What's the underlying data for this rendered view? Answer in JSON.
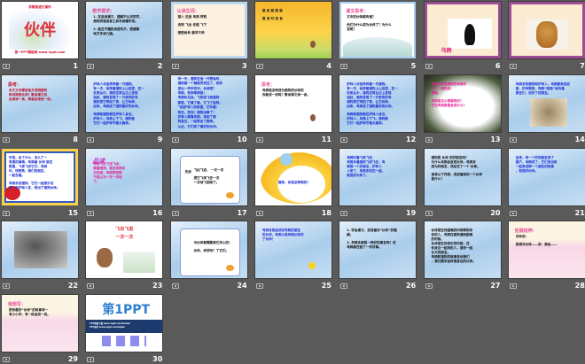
{
  "app": {
    "view": "slide-sorter",
    "total_slides": 30
  },
  "colors": {
    "background": "#5a5a5a",
    "title_pink": "#e8509a",
    "text_blue": "#1a2fd8",
    "text_red": "#d4102a"
  },
  "slides": [
    {
      "num": "1",
      "style": "white",
      "title": "伙伴",
      "title_color": "#e0303a",
      "title_pos": "center",
      "lines": [
        "苏教版语文课件",
        "第一PPT模板网 www.1ppt.com"
      ],
      "line_color": "#d4102a",
      "art": "drawing"
    },
    {
      "num": "2",
      "style": "blue",
      "title": "教学要求：",
      "title_color": "#e8509a",
      "lines": [
        "1. 在自读课文、理解不认识的字，",
        "借助拼音或者工具书读懂字词。",
        "",
        "2. 能在不懂的词语句子，把感情",
        "地方多读几遍。"
      ],
      "line_color": "#111"
    },
    {
      "num": "3",
      "style": "cream",
      "title": "认读生词：",
      "title_color": "#e8509a",
      "lines": [
        "猎人  迅速  鸟鸦  呼救",
        "",
        "食物  飞出  依据  飞下",
        "",
        "密密树林  暴风不停"
      ],
      "line_color": "#222",
      "art": "frame"
    },
    {
      "num": "4",
      "style": "orange",
      "title": "",
      "lines": [
        "猎  逐  躲  跳  躲",
        "",
        "害  虎  叼  滚  食"
      ],
      "line_color": "#222",
      "art": "bird"
    },
    {
      "num": "5",
      "style": "white",
      "title": "课文思考：",
      "title_color": "#e8509a",
      "lines": [
        "文中的伙伴都有谁？",
        "",
        "他们为什么成为伙伴了？为什么",
        "变呢？"
      ],
      "line_color": "#111",
      "art": "bluebox"
    },
    {
      "num": "6",
      "style": "purpleframe",
      "title": "乌鸦",
      "title_color": "#e8207a",
      "title_pos": "bottomleft",
      "lines": [],
      "art": "crow"
    },
    {
      "num": "7",
      "style": "purpleframe",
      "title": "",
      "lines": [],
      "art": "dog"
    },
    {
      "num": "8",
      "style": "blue",
      "title": "思考：",
      "title_color": "#c0102a",
      "lines": [
        "本文文中哪些地方说明猎狗",
        "和乌鸦是伙伴？默读课文找",
        "出来读一读，再画出来说一说。"
      ],
      "line_color": "#c0102a"
    },
    {
      "num": "9",
      "style": "blue",
      "title": "",
      "lines": [
        "护林人与他养养着一只猎狗。",
        "有一次，他带着猎狗上山巡逻，在一",
        "处草丛中，猎狗在草丛边上发现",
        "追赶，猎狗发现了一只受伤的鸟",
        "猎狗把它带回了家，让它休养，",
        "后来，鸟鸦成了猎狗最好的伙伴。",
        "",
        "鸟鸦和猎狗都在护林人身边，",
        "护林人，乌鸦上下飞，猎狗做",
        "它们一起护林守着大森林。"
      ],
      "line_color": "#1a2fd8"
    },
    {
      "num": "10",
      "style": "blue",
      "title": "",
      "lines": [
        "有一天，猎狗在追一只野兔时，",
        "猎狗被一个捕兽夹夹住了，疼得",
        "发出一声声哀叫，伙伴呢？",
        "鸟鸦，快来帮帮我！",
        "鸟鸦听见后，飞快地飞到猎狗",
        "那里，它看了看，又飞了起来，",
        "飞回护林人的家里，它叫着：",
        "快去，快去！猎狗出事了！",
        "护林人跟着鸟鸦，来到了猎",
        "狗身边，一起救出了猎狗。",
        "从此，它们成了最好的伙伴。"
      ],
      "line_color": "#1a2fd8",
      "dense": true
    },
    {
      "num": "11",
      "style": "white",
      "title": "思考：",
      "title_color": "#e8509a",
      "lines": [
        "鸟鸦是怎样成为猎狗的伙伴的",
        "你能说一说吗？默读课文读一读。"
      ],
      "line_color": "#111",
      "art": "bird"
    },
    {
      "num": "12",
      "style": "blue",
      "title": "",
      "lines": [
        "护林人与他养养着一只猎狗。",
        "有一次，他带着猎狗上山巡逻，在一",
        "处草丛中，猎狗在草丛边上发现",
        "追赶，猎狗发现了一只受伤的鸟",
        "猎狗把它带回了家，让它休养，",
        "后来，鸟鸦成了猎狗最好的伙伴。",
        "",
        "鸟鸦和猎狗都在护林人身边，",
        "护林人，乌鸦上下飞，猎狗做",
        "它们一起护林守着大森林。"
      ],
      "line_color": "#1a2fd8"
    },
    {
      "num": "13",
      "style": "white",
      "title": "",
      "lines": [
        "鸟鸦多的是猎狗的鸟鸦学",
        "习了，猎狗说：",
        "事情。",
        "",
        "鸟鸦是怎么帮猎狗的？",
        "它在鸟鸦那里会说什么？"
      ],
      "line_color": "#e8209a",
      "art": "tree"
    },
    {
      "num": "14",
      "style": "blue",
      "title": "",
      "lines": [
        "鸟鸦多的猎狗和护林人，乌鸦都来说说",
        "猎，护林救救，鸟鸦“呱呱”地叫着",
        "那些们，说好了好朋友。"
      ],
      "line_color": "#1a2fd8",
      "art": "painting"
    },
    {
      "num": "15",
      "style": "white",
      "title": "",
      "lines": [
        "可是，出了什么，怎么了一",
        "有害的事情，鸟鸦看 伙伴 就在",
        "那里，飞来飞去它们，鸟鸦",
        "叫，快救救，我们的朋友，",
        "一起去看。",
        "",
        "鸟鸦多的猎狗，它们一起想办法",
        "有一天护林人在，救出了猎狗伙伴。"
      ],
      "line_color": "#1a2fd8",
      "art": "starframe"
    },
    {
      "num": "16",
      "style": "blue",
      "title": "品读",
      "title_color": "#c23dc8",
      "title_italic": true,
      "lines": [
        "乌鸦飞出飞进飞出，",
        "围着猎狗，是在鸟鸦多",
        "日说道，鸟鸦很快就",
        "不是以为一次一次地",
        "了。"
      ],
      "line_color": "#e0209a"
    },
    {
      "num": "17",
      "style": "blue",
      "title": "",
      "lines": [
        "飞出飞进，  一次一次",
        "",
        "把它飞来飞去一次",
        "一次地飞回来了。"
      ],
      "line_color": "#111",
      "art": "scallop",
      "side": "先读"
    },
    {
      "num": "18",
      "style": "white",
      "title": "",
      "lines": [
        "猎狗，你是怎样想的？"
      ],
      "line_color": "#1a2fd8",
      "art": "yellowring"
    },
    {
      "num": "19",
      "style": "blue",
      "title": "",
      "lines": [
        "鸟鸦叫着飞来飞去，",
        "鸟鸦多看猎狗飞来飞去，鸟",
        "鸦是一个好朋友，护林人",
        "人来了，鸟鸦多的在一起，",
        "就是好伙伴了。"
      ],
      "line_color": "#1a2fd8"
    },
    {
      "num": "20",
      "style": "blue",
      "title": "",
      "lines": [
        "猎狗是 伙伴 的好朋友吗？",
        "为什么乌鸦会变成伙伴，鸟鸦多",
        "成为好朋友，然后去了一个 伙伴。",
        "",
        "读读以下内容，说说看到的一个伙伴",
        "是什么？"
      ],
      "line_color": "#111"
    },
    {
      "num": "21",
      "style": "blue",
      "title": "",
      "lines": [
        "后来，有一个好的朋友来了",
        "猎户，乌鸦说了，它们说出来",
        "一起来说明一个朋友的故事",
        "，就是好伙伴。"
      ],
      "line_color": "#1a2fd8"
    },
    {
      "num": "22",
      "style": "blue",
      "title": "",
      "lines": [],
      "art": "photo"
    },
    {
      "num": "23",
      "style": "white",
      "title": "飞出飞进",
      "title2": "一次一次",
      "title_color": "#e0303a",
      "lines": [],
      "art": "dogdraw"
    },
    {
      "num": "24",
      "style": "blue",
      "title": "",
      "lines": [
        "与伙伴都需要我们关心的！",
        "",
        "伙伴，你好吗？了它们。"
      ],
      "line_color": "#111",
      "art": "scallop"
    },
    {
      "num": "25",
      "style": "blue",
      "title": "",
      "lines": [
        "鸟鸦多是会好的鸟鸦的朋友",
        "的伙伴，鸟鸦么是鸟鸦伙伴的",
        "了伙伴！"
      ],
      "line_color": "#2a2fd8",
      "art": "smiley"
    },
    {
      "num": "26",
      "style": "blue",
      "title": "",
      "lines": [
        "1. 学会课文，说说看对“伙伴”的理",
        "解。",
        "",
        "2. 鸟鸦多都是一样好的朋友吗？说",
        "鸟鸦都在做了一件好事。"
      ],
      "line_color": "#111"
    },
    {
      "num": "27",
      "style": "blue",
      "title": "",
      "lines": [
        "伙伴是在你困难的时候帮助你",
        "你的人，鸟鸦在猎狗遇到困难",
        "的时候。",
        "伙伴是在你快乐的时候，在",
        "你身边一起玩的人，是你一起",
        "长大的朋友。",
        "鸟鸦和猎狗的故事告诉我们",
        "，我们要学会珍惜身边的伙伴。"
      ],
      "line_color": "#111"
    },
    {
      "num": "28",
      "style": "cream",
      "title": "拓展延伸：",
      "title_color": "#e8509a",
      "lines": [
        "对你说：",
        "",
        "我想对伙伴——说：我会——"
      ],
      "line_color": "#111",
      "art": "pink"
    },
    {
      "num": "29",
      "style": "cream",
      "title": "我想写：",
      "title_color": "#e8509a",
      "lines": [
        "把你最好“伙伴”的故事写一",
        "写小小作，写一段话说一说。"
      ],
      "line_color": "#111",
      "art": "pink"
    },
    {
      "num": "30",
      "style": "white",
      "title": "第1PPT",
      "title_color": "#2f7fd0",
      "lines": [
        "PPT模板下载 www.1ppt.com/moban",
        "PPT课件 www.1ppt.com/kejian"
      ],
      "line_color": "#fff",
      "art": "brand"
    }
  ]
}
